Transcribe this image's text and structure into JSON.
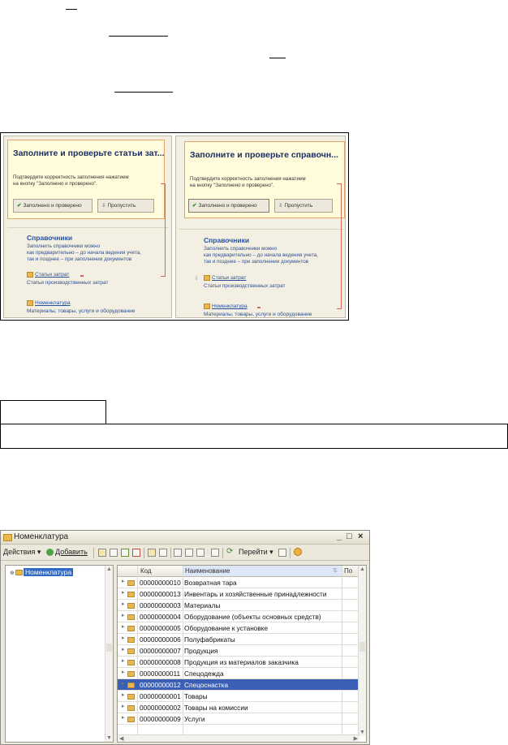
{
  "screenshot_left": {
    "note_title": "Заполните и проверьте статьи зат...",
    "note_text": [
      "Подтвердите корректность заполнения нажатием",
      "на кнопку \"Заполнено и проверено\"."
    ],
    "btn_done": "Заполнено и проверено",
    "btn_skip": "Пропустить",
    "section_title": "Справочники",
    "section_desc": [
      "Заполнить справочники можно",
      "как предварительно – до начала ведения учета,",
      "так и позднее – при заполнении документов"
    ],
    "link1": "Статьи затрат",
    "link1_sub": "Статьи производственных затрат",
    "link2": "Номенклатура",
    "link2_sub": "Материалы, товары, услуги и оборудование"
  },
  "screenshot_right": {
    "note_title": "Заполните и проверьте справочн...",
    "note_text": [
      "Подтвердите корректность заполнения нажатием",
      "на кнопку \"Заполнено и проверено\"."
    ],
    "btn_done": "Заполнено и проверено",
    "btn_skip": "Пропустить",
    "section_title": "Справочники",
    "section_desc": [
      "Заполнить справочники можно",
      "как предварительно – до начала ведения учета,",
      "так и позднее – при заполнении документов"
    ],
    "link1": "Статьи затрат",
    "link1_sub": "Статьи производственных затрат",
    "link2": "Номенклатура",
    "link2_sub": "Материалы, товары, услуги и оборудование"
  },
  "window": {
    "title": "Номенклатура",
    "min": "_",
    "max": "□",
    "close": "×",
    "toolbar": {
      "actions": "Действия ▾",
      "add": "Добавить",
      "goto": "Перейти ▾"
    },
    "tree_root": "Номенклатура",
    "columns": {
      "code": "Код",
      "name": "Наименование",
      "extra": "По"
    },
    "rows": [
      {
        "code": "00000000010",
        "name": "Возвратная тара"
      },
      {
        "code": "00000000013",
        "name": "Инвентарь и хозяйственные принадлежности"
      },
      {
        "code": "00000000003",
        "name": "Материалы"
      },
      {
        "code": "00000000004",
        "name": "Оборудование (объекты основных средств)"
      },
      {
        "code": "00000000005",
        "name": "Оборудование к установке"
      },
      {
        "code": "00000000006",
        "name": "Полуфабрикаты"
      },
      {
        "code": "00000000007",
        "name": "Продукция"
      },
      {
        "code": "00000000008",
        "name": "Продукция из материалов заказчика"
      },
      {
        "code": "00000000011",
        "name": "Спецодежда"
      },
      {
        "code": "00000000012",
        "name": "Спецоснастка",
        "selected": true
      },
      {
        "code": "00000000001",
        "name": "Товары"
      },
      {
        "code": "00000000002",
        "name": "Товары на комиссии"
      },
      {
        "code": "00000000009",
        "name": "Услуги"
      }
    ]
  }
}
